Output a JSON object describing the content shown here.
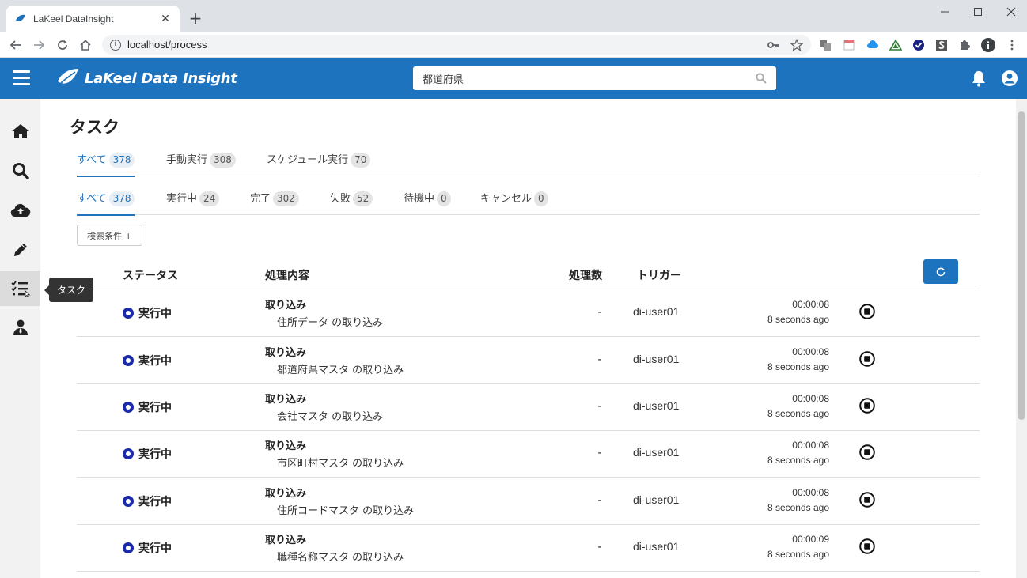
{
  "browser": {
    "tab_title": "LaKeel DataInsight",
    "tab_close": "✕",
    "new_tab": "+",
    "url": "localhost/process",
    "info": "i"
  },
  "app": {
    "logo_text": "LaKeel Data Insight",
    "search_placeholder": "都道府県"
  },
  "sidebar": {
    "tooltip": "タスク"
  },
  "page": {
    "title": "タスク",
    "filter_button": "検索条件 +"
  },
  "primary_tabs": [
    {
      "label": "すべて",
      "count": "378"
    },
    {
      "label": "手動実行",
      "count": "308"
    },
    {
      "label": "スケジュール実行",
      "count": "70"
    }
  ],
  "status_tabs": [
    {
      "label": "すべて",
      "count": "378"
    },
    {
      "label": "実行中",
      "count": "24"
    },
    {
      "label": "完了",
      "count": "302"
    },
    {
      "label": "失敗",
      "count": "52"
    },
    {
      "label": "待機中",
      "count": "0"
    },
    {
      "label": "キャンセル",
      "count": "0"
    }
  ],
  "table": {
    "headers": {
      "status": "ステータス",
      "content": "処理内容",
      "count": "処理数",
      "trigger": "トリガー"
    },
    "rows": [
      {
        "status": "実行中",
        "type": "取り込み",
        "desc": "住所データ の取り込み",
        "count": "-",
        "trigger": "di-user01",
        "elapsed": "00:00:08",
        "ago": "8 seconds ago"
      },
      {
        "status": "実行中",
        "type": "取り込み",
        "desc": "都道府県マスタ の取り込み",
        "count": "-",
        "trigger": "di-user01",
        "elapsed": "00:00:08",
        "ago": "8 seconds ago"
      },
      {
        "status": "実行中",
        "type": "取り込み",
        "desc": "会社マスタ の取り込み",
        "count": "-",
        "trigger": "di-user01",
        "elapsed": "00:00:08",
        "ago": "8 seconds ago"
      },
      {
        "status": "実行中",
        "type": "取り込み",
        "desc": "市区町村マスタ の取り込み",
        "count": "-",
        "trigger": "di-user01",
        "elapsed": "00:00:08",
        "ago": "8 seconds ago"
      },
      {
        "status": "実行中",
        "type": "取り込み",
        "desc": "住所コードマスタ の取り込み",
        "count": "-",
        "trigger": "di-user01",
        "elapsed": "00:00:08",
        "ago": "8 seconds ago"
      },
      {
        "status": "実行中",
        "type": "取り込み",
        "desc": "職種名称マスタ の取り込み",
        "count": "-",
        "trigger": "di-user01",
        "elapsed": "00:00:09",
        "ago": "8 seconds ago"
      }
    ]
  },
  "colors": {
    "brand": "#1e73be",
    "running_dot": "#1a2aa8"
  }
}
